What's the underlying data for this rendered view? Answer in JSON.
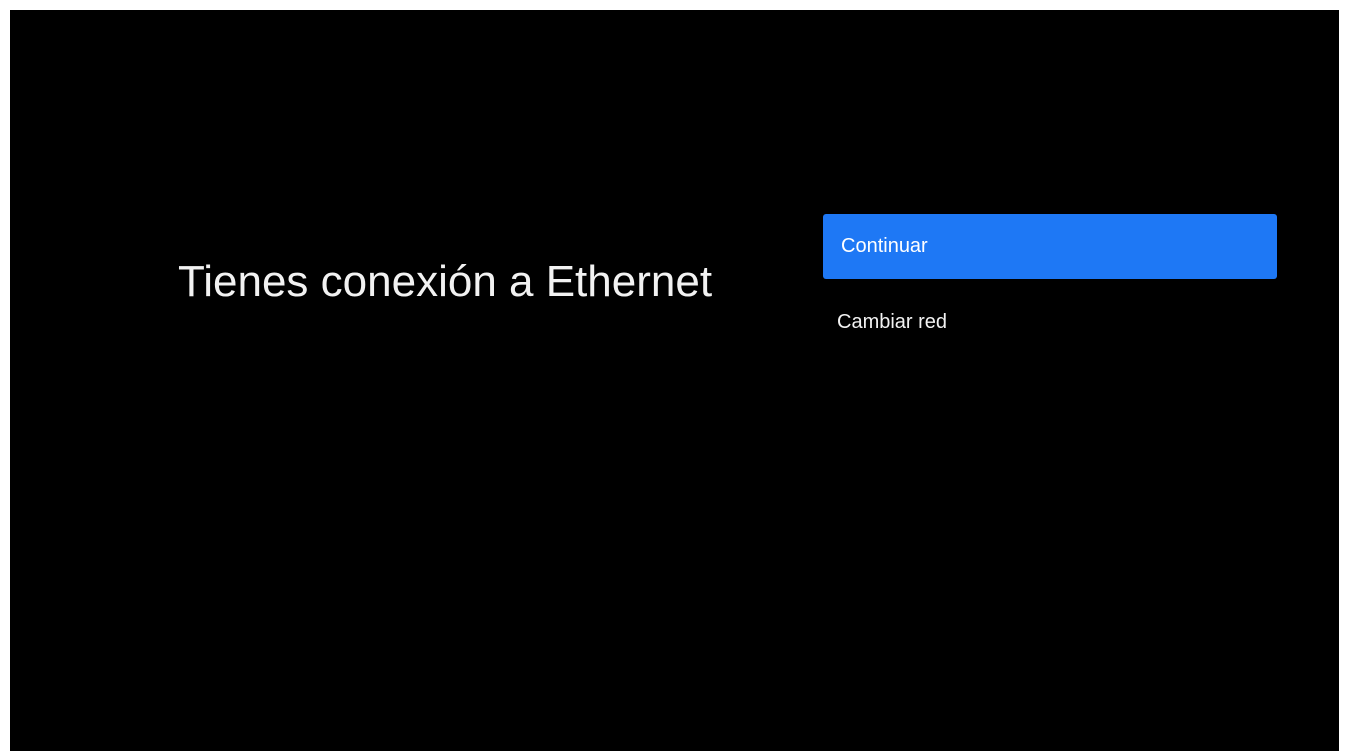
{
  "screen": {
    "title": "Tienes conexión a Ethernet",
    "options": [
      {
        "label": "Continuar",
        "focused": true
      },
      {
        "label": "Cambiar red",
        "focused": false
      }
    ],
    "colors": {
      "background": "#000000",
      "text": "#f2f2f2",
      "focus_highlight": "#1e78f5"
    }
  }
}
